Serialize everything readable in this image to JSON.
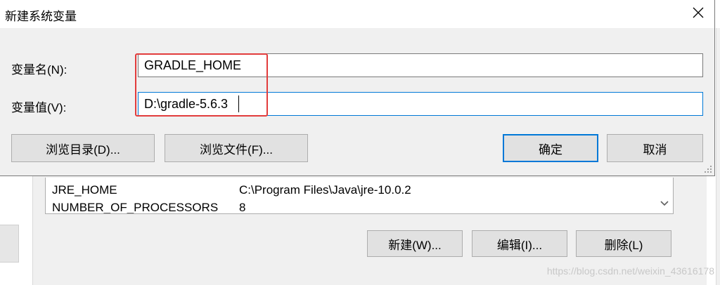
{
  "dialog": {
    "title": "新建系统变量",
    "name_label": "变量名(N):",
    "name_value": "GRADLE_HOME",
    "value_label": "变量值(V):",
    "value_value": "D:\\gradle-5.6.3",
    "browse_dir_label": "浏览目录(D)...",
    "browse_file_label": "浏览文件(F)...",
    "ok_label": "确定",
    "cancel_label": "取消",
    "close_icon": "close-icon"
  },
  "background": {
    "variables": [
      {
        "name": "JRE_HOME",
        "value": "C:\\Program Files\\Java\\jre-10.0.2"
      },
      {
        "name": "NUMBER_OF_PROCESSORS",
        "value": "8"
      }
    ],
    "new_label": "新建(W)...",
    "edit_label": "编辑(I)...",
    "delete_label": "删除(L)"
  },
  "watermark": "https://blog.csdn.net/weixin_43616178",
  "colors": {
    "highlight": "#e23c3c",
    "focus": "#0078d7",
    "dialog_bg": "#f0f0f0",
    "button_bg": "#e1e1e1"
  }
}
